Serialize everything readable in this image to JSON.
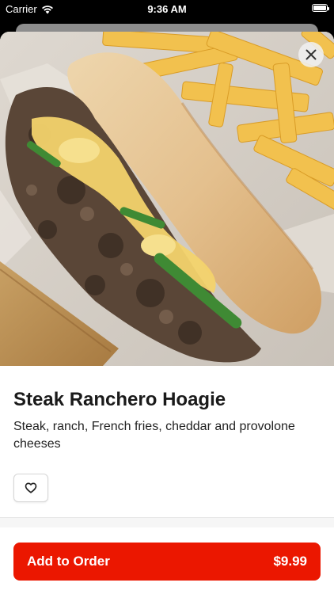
{
  "status_bar": {
    "carrier": "Carrier",
    "time": "9:36 AM",
    "battery_level": 1.0
  },
  "hero": {
    "image": "steak-hoagie-with-fries-photo"
  },
  "close": {
    "icon": "close-icon"
  },
  "item": {
    "title": "Steak Ranchero Hoagie",
    "description": "Steak, ranch, French fries, cheddar and provolone cheeses"
  },
  "favorite": {
    "icon": "heart-icon"
  },
  "order_button": {
    "label": "Add to Order",
    "price": "$9.99",
    "color": "#eb1700"
  }
}
